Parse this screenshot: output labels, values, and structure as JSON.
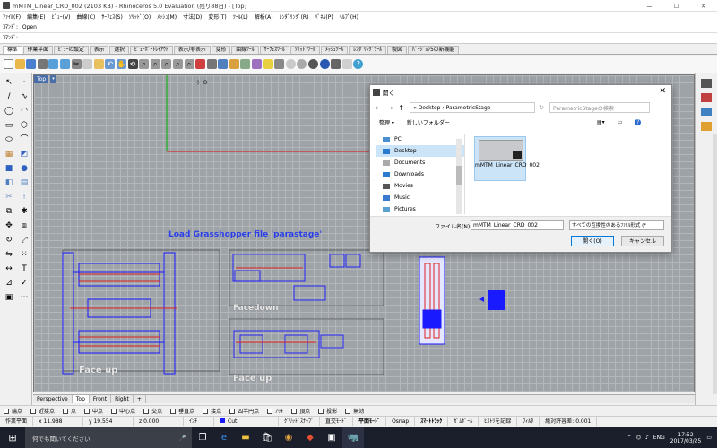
{
  "window": {
    "title": "mMTM_Linear_CRD_002 (2103 KB) - Rhinoceros 5.0 Evaluation (残り88日) - [Top]"
  },
  "menu": [
    "ﾌｧｲﾙ(F)",
    "編集(E)",
    "ﾋﾞｭｰ(V)",
    "曲線(C)",
    "ｻｰﾌｪｽ(S)",
    "ｿﾘｯﾄﾞ(O)",
    "ﾒｯｼｭ(M)",
    "寸法(D)",
    "変形(T)",
    "ﾂｰﾙ(L)",
    "解析(A)",
    "ﾚﾝﾀﾞﾘﾝｸﾞ(R)",
    "ﾊﾟﾈﾙ(P)",
    "ﾍﾙﾌﾟ(H)"
  ],
  "command": {
    "history": "ｺﾏﾝﾄﾞ: _Open",
    "prompt": "ｺﾏﾝﾄﾞ:"
  },
  "toolbar_tabs": [
    "標準",
    "作業平面",
    "ﾋﾞｭｰの設定",
    "表示",
    "選択",
    "ﾋﾞｭｰﾎﾟｰﾄﾚｲｱｳﾄ",
    "表示/非表示",
    "変形",
    "曲線ﾂｰﾙ",
    "ｻｰﾌｪｽﾂｰﾙ",
    "ｿﾘｯﾄﾞﾂｰﾙ",
    "ﾒｯｼｭﾂｰﾙ",
    "ﾚﾝﾀﾞﾘﾝｸﾞﾂｰﾙ",
    "製図",
    "ﾊﾞｰｼﾞｮﾝ5の新機能"
  ],
  "viewport": {
    "label": "Top",
    "annotations": {
      "load": "Load Grasshopper file 'parastage'",
      "facedown": "Facedown",
      "faceup1": "Face up",
      "faceup2": "Face up"
    },
    "tabs": [
      "Perspective",
      "Top",
      "Front",
      "Right",
      "+"
    ]
  },
  "osnap": [
    "端点",
    "近接点",
    "点",
    "中点",
    "中心点",
    "交点",
    "垂直点",
    "接点",
    "四半円点",
    "ﾉｯﾄ",
    "頂点",
    "投影",
    "無効"
  ],
  "status": {
    "cplane": "作業平面",
    "x": "x 11.988",
    "y": "y 19.554",
    "z": "z 0.000",
    "units": "ｲﾝﾁ",
    "layer": "Cut",
    "items": [
      "ｸﾞﾘｯﾄﾞｽﾅｯﾌﾟ",
      "直交ﾓｰﾄﾞ",
      "平面ﾓｰﾄﾞ",
      "Osnap",
      "ｽﾏｰﾄﾄﾗｯｸ",
      "ｶﾞﾑﾎﾞｰﾙ",
      "ﾋｽﾄﾘを記録",
      "ﾌｨﾙﾀ",
      "絶対許容差: 0.001"
    ]
  },
  "dialog": {
    "title": "開く",
    "breadcrumb": "« Desktop › ParametricStage",
    "search_placeholder": "ParametricStageの検索",
    "organize": "整理 ▾",
    "new_folder": "新しいフォルダー",
    "tree": [
      "PC",
      "Desktop",
      "Documents",
      "Downloads",
      "Movies",
      "Music",
      "Pictures"
    ],
    "file": "mMTM_Linear_CRD_002",
    "filename_label": "ファイル名(N):",
    "filename_value": "mMTM_Linear_CRD_002",
    "filetype": "すべての互換性のあるﾌｧｲﾙ形式 (*",
    "open_btn": "開く(O)",
    "cancel_btn": "キャンセル"
  },
  "taskbar": {
    "search": "何でも聞いてください",
    "lang": "ENG",
    "time": "17:52",
    "date": "2017/03/25"
  },
  "colors": {
    "accent": "#0078d7",
    "annotation": "#2a3fe8",
    "geometry_blue": "#1a1aff",
    "geometry_red": "#e02020"
  }
}
